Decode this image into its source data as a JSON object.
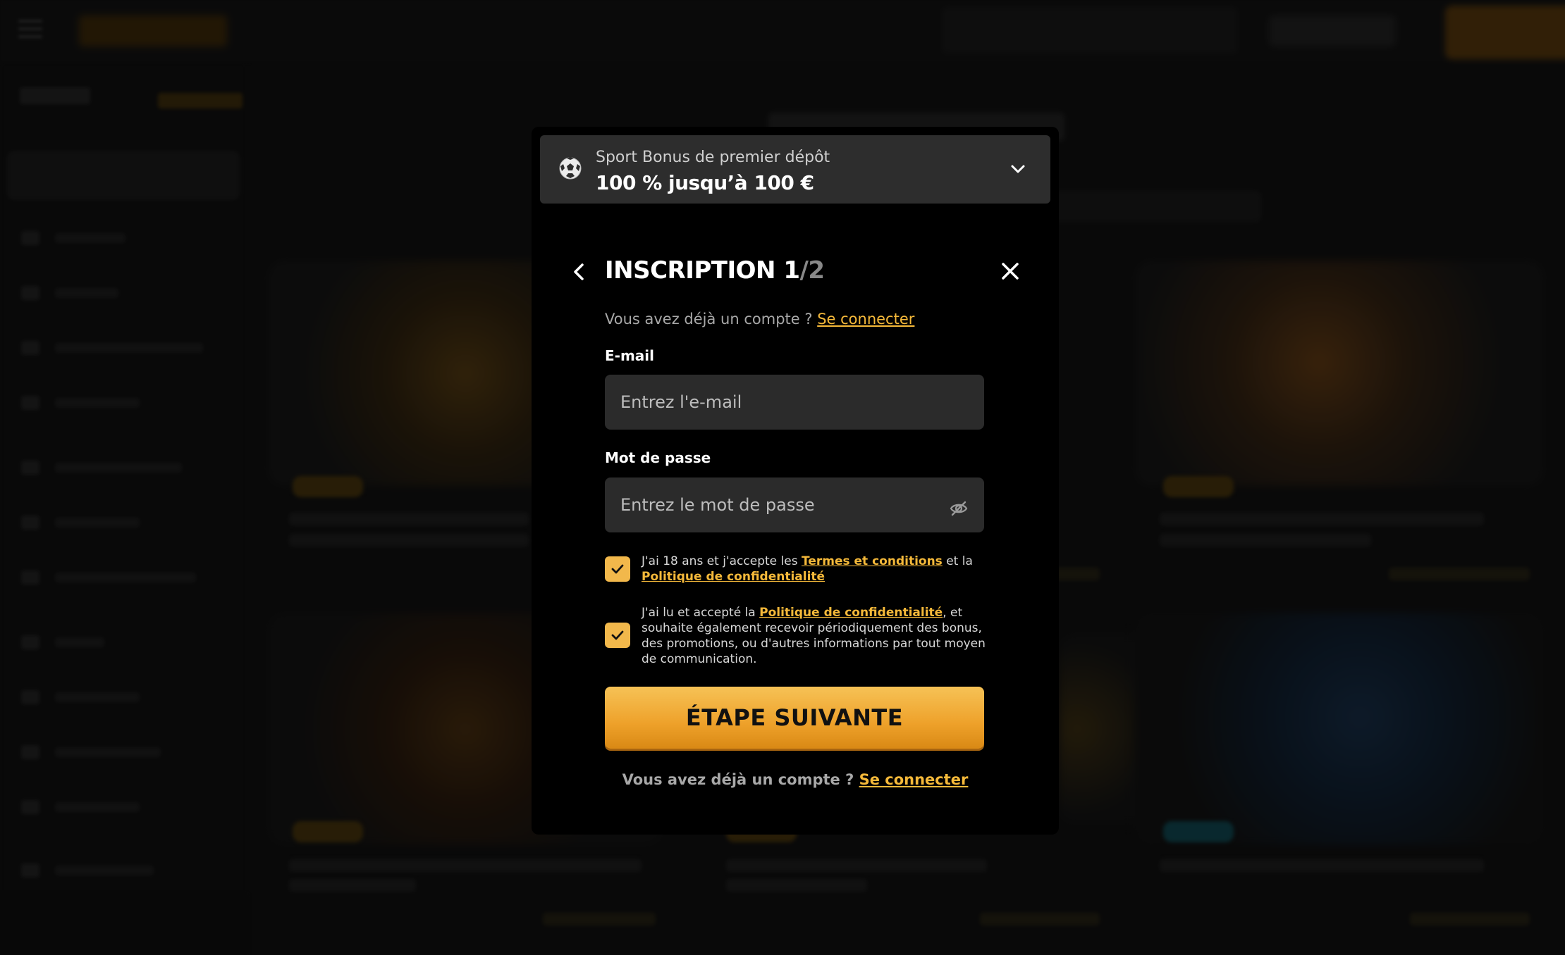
{
  "bonus": {
    "subtitle": "Sport Bonus de premier dépôt",
    "amount": "100 % jusqu’à 100 €"
  },
  "form": {
    "title_step": "INSCRIPTION 1",
    "title_total": "/2",
    "already_text": "Vous avez déjà un compte ?",
    "login_link": "Se connecter",
    "email_label": "E-mail",
    "email_placeholder": "Entrez l'e-mail",
    "password_label": "Mot de passe",
    "password_placeholder": "Entrez le mot de passe",
    "checkbox1": {
      "text_before": "J'ai 18 ans et j'accepte les ",
      "link1": "Termes et conditions",
      "text_middle": " et la ",
      "link2": "Politique de confidentialité",
      "checked": true
    },
    "checkbox2": {
      "text_before": "J'ai lu et accepté la ",
      "link": "Politique de confidentialité",
      "text_after": ", et souhaite également recevoir périodiquement des bonus, des promotions, ou d'autres informations par tout moyen de communication.",
      "checked": true
    },
    "next_button": "ÉTAPE SUIVANTE",
    "footer_text": "Vous avez déjà un compte ?",
    "footer_link": "Se connecter"
  },
  "colors": {
    "accent": "#f5b93a",
    "modal_bg": "#000000",
    "input_bg": "#2b2b2b"
  },
  "icons": {
    "bonus": "soccer-ball-icon",
    "expand": "chevron-down-icon",
    "back": "chevron-left-icon",
    "close": "close-icon",
    "password_toggle": "eye-off-icon",
    "checkbox": "check-icon"
  }
}
